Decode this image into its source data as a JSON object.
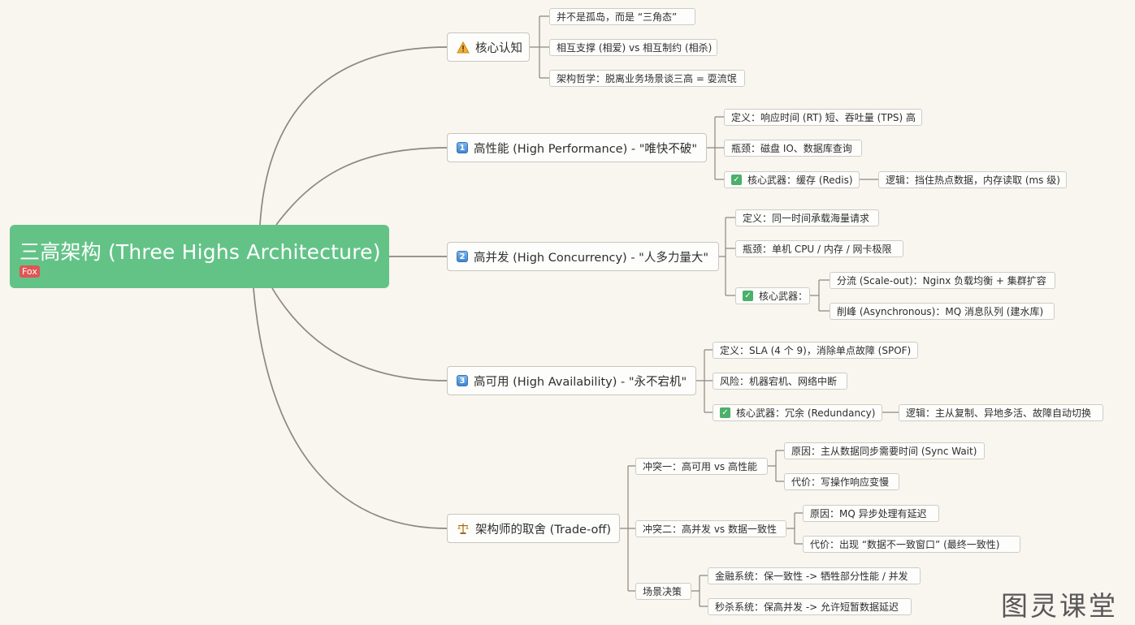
{
  "root": {
    "title": "三高架构 (Three Highs Architecture)",
    "tag": "Fox"
  },
  "branches": [
    {
      "label": "核心认知",
      "icon": "warning-icon",
      "children": [
        "并不是孤岛，而是 “三角态”",
        "相互支撑 (相爱) vs 相互制约 (相杀)",
        "架构哲学：脱离业务场景谈三高 = 耍流氓"
      ]
    },
    {
      "label": "高性能 (High Performance) - \"唯快不破\"",
      "icon": "number-1-icon",
      "badge": "1",
      "children": [
        "定义：响应时间 (RT) 短、吞吐量 (TPS) 高",
        "瓶颈：磁盘 IO、数据库查询",
        "核心武器：缓存 (Redis)"
      ],
      "sub": "逻辑：挡住热点数据，内存读取 (ms 级)"
    },
    {
      "label": "高并发 (High Concurrency) - \"人多力量大\"",
      "icon": "number-2-icon",
      "badge": "2",
      "children": [
        "定义：同一时间承载海量请求",
        "瓶颈：单机 CPU / 内存 / 网卡极限",
        "核心武器："
      ],
      "subs": [
        "分流 (Scale-out)：Nginx 负载均衡 + 集群扩容",
        "削峰 (Asynchronous)：MQ 消息队列 (建水库)"
      ]
    },
    {
      "label": "高可用 (High Availability) - \"永不宕机\"",
      "icon": "number-3-icon",
      "badge": "3",
      "children": [
        "定义：SLA (4 个 9)，消除单点故障 (SPOF)",
        "风险：机器宕机、网络中断",
        "核心武器：冗余 (Redundancy)"
      ],
      "sub": "逻辑：主从复制、异地多活、故障自动切换"
    },
    {
      "label": "架构师的取舍 (Trade-off)",
      "icon": "scale-icon",
      "groups": [
        {
          "label": "冲突一：高可用 vs 高性能",
          "children": [
            "原因：主从数据同步需要时间 (Sync Wait)",
            "代价：写操作响应变慢"
          ]
        },
        {
          "label": "冲突二：高并发 vs 数据一致性",
          "children": [
            "原因：MQ 异步处理有延迟",
            "代价：出现 “数据不一致窗口” (最终一致性)"
          ]
        },
        {
          "label": "场景决策",
          "children": [
            "金融系统：保一致性 -> 牺牲部分性能 / 并发",
            "秒杀系统：保高并发 -> 允许短暂数据延迟"
          ]
        }
      ]
    }
  ],
  "watermark": "图灵课堂",
  "colors": {
    "root": "#63c387",
    "tag": "#e05555",
    "background": "#f9f5ef",
    "line": "#8d8780",
    "check": "#4caf6a",
    "badge": "#3f86d0"
  }
}
